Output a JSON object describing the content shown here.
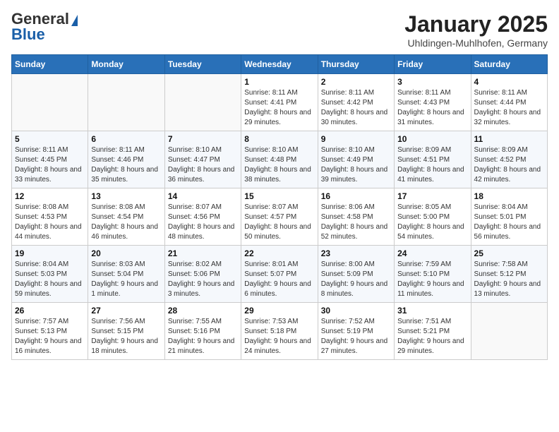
{
  "header": {
    "logo_line1": "General",
    "logo_line2": "Blue",
    "month": "January 2025",
    "location": "Uhldingen-Muhlhofen, Germany"
  },
  "weekdays": [
    "Sunday",
    "Monday",
    "Tuesday",
    "Wednesday",
    "Thursday",
    "Friday",
    "Saturday"
  ],
  "weeks": [
    [
      {
        "day": "",
        "info": ""
      },
      {
        "day": "",
        "info": ""
      },
      {
        "day": "",
        "info": ""
      },
      {
        "day": "1",
        "info": "Sunrise: 8:11 AM\nSunset: 4:41 PM\nDaylight: 8 hours and 29 minutes."
      },
      {
        "day": "2",
        "info": "Sunrise: 8:11 AM\nSunset: 4:42 PM\nDaylight: 8 hours and 30 minutes."
      },
      {
        "day": "3",
        "info": "Sunrise: 8:11 AM\nSunset: 4:43 PM\nDaylight: 8 hours and 31 minutes."
      },
      {
        "day": "4",
        "info": "Sunrise: 8:11 AM\nSunset: 4:44 PM\nDaylight: 8 hours and 32 minutes."
      }
    ],
    [
      {
        "day": "5",
        "info": "Sunrise: 8:11 AM\nSunset: 4:45 PM\nDaylight: 8 hours and 33 minutes."
      },
      {
        "day": "6",
        "info": "Sunrise: 8:11 AM\nSunset: 4:46 PM\nDaylight: 8 hours and 35 minutes."
      },
      {
        "day": "7",
        "info": "Sunrise: 8:10 AM\nSunset: 4:47 PM\nDaylight: 8 hours and 36 minutes."
      },
      {
        "day": "8",
        "info": "Sunrise: 8:10 AM\nSunset: 4:48 PM\nDaylight: 8 hours and 38 minutes."
      },
      {
        "day": "9",
        "info": "Sunrise: 8:10 AM\nSunset: 4:49 PM\nDaylight: 8 hours and 39 minutes."
      },
      {
        "day": "10",
        "info": "Sunrise: 8:09 AM\nSunset: 4:51 PM\nDaylight: 8 hours and 41 minutes."
      },
      {
        "day": "11",
        "info": "Sunrise: 8:09 AM\nSunset: 4:52 PM\nDaylight: 8 hours and 42 minutes."
      }
    ],
    [
      {
        "day": "12",
        "info": "Sunrise: 8:08 AM\nSunset: 4:53 PM\nDaylight: 8 hours and 44 minutes."
      },
      {
        "day": "13",
        "info": "Sunrise: 8:08 AM\nSunset: 4:54 PM\nDaylight: 8 hours and 46 minutes."
      },
      {
        "day": "14",
        "info": "Sunrise: 8:07 AM\nSunset: 4:56 PM\nDaylight: 8 hours and 48 minutes."
      },
      {
        "day": "15",
        "info": "Sunrise: 8:07 AM\nSunset: 4:57 PM\nDaylight: 8 hours and 50 minutes."
      },
      {
        "day": "16",
        "info": "Sunrise: 8:06 AM\nSunset: 4:58 PM\nDaylight: 8 hours and 52 minutes."
      },
      {
        "day": "17",
        "info": "Sunrise: 8:05 AM\nSunset: 5:00 PM\nDaylight: 8 hours and 54 minutes."
      },
      {
        "day": "18",
        "info": "Sunrise: 8:04 AM\nSunset: 5:01 PM\nDaylight: 8 hours and 56 minutes."
      }
    ],
    [
      {
        "day": "19",
        "info": "Sunrise: 8:04 AM\nSunset: 5:03 PM\nDaylight: 8 hours and 59 minutes."
      },
      {
        "day": "20",
        "info": "Sunrise: 8:03 AM\nSunset: 5:04 PM\nDaylight: 9 hours and 1 minute."
      },
      {
        "day": "21",
        "info": "Sunrise: 8:02 AM\nSunset: 5:06 PM\nDaylight: 9 hours and 3 minutes."
      },
      {
        "day": "22",
        "info": "Sunrise: 8:01 AM\nSunset: 5:07 PM\nDaylight: 9 hours and 6 minutes."
      },
      {
        "day": "23",
        "info": "Sunrise: 8:00 AM\nSunset: 5:09 PM\nDaylight: 9 hours and 8 minutes."
      },
      {
        "day": "24",
        "info": "Sunrise: 7:59 AM\nSunset: 5:10 PM\nDaylight: 9 hours and 11 minutes."
      },
      {
        "day": "25",
        "info": "Sunrise: 7:58 AM\nSunset: 5:12 PM\nDaylight: 9 hours and 13 minutes."
      }
    ],
    [
      {
        "day": "26",
        "info": "Sunrise: 7:57 AM\nSunset: 5:13 PM\nDaylight: 9 hours and 16 minutes."
      },
      {
        "day": "27",
        "info": "Sunrise: 7:56 AM\nSunset: 5:15 PM\nDaylight: 9 hours and 18 minutes."
      },
      {
        "day": "28",
        "info": "Sunrise: 7:55 AM\nSunset: 5:16 PM\nDaylight: 9 hours and 21 minutes."
      },
      {
        "day": "29",
        "info": "Sunrise: 7:53 AM\nSunset: 5:18 PM\nDaylight: 9 hours and 24 minutes."
      },
      {
        "day": "30",
        "info": "Sunrise: 7:52 AM\nSunset: 5:19 PM\nDaylight: 9 hours and 27 minutes."
      },
      {
        "day": "31",
        "info": "Sunrise: 7:51 AM\nSunset: 5:21 PM\nDaylight: 9 hours and 29 minutes."
      },
      {
        "day": "",
        "info": ""
      }
    ]
  ]
}
